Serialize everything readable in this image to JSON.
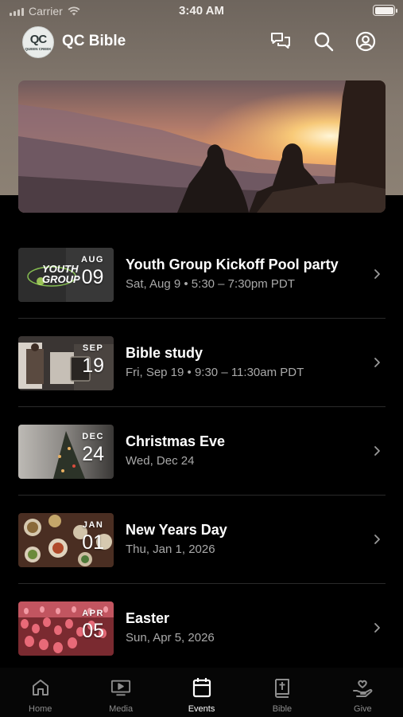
{
  "status_bar": {
    "carrier": "Carrier",
    "time": "3:40 AM"
  },
  "header": {
    "app_title": "QC Bible",
    "logo_mark": "QC",
    "logo_sub": "QUEEN CREEK",
    "icons": [
      "chat-icon",
      "search-icon",
      "account-icon"
    ]
  },
  "hero": {
    "image": "sunset-mountain-people"
  },
  "events": [
    {
      "title": "Youth Group Kickoff Pool party",
      "subtitle": "Sat, Aug 9 • 5:30 – 7:30pm PDT",
      "month": "AUG",
      "day": "09",
      "thumb_text": "YOUTH GROUP"
    },
    {
      "title": "Bible study",
      "subtitle": "Fri, Sep 19 • 9:30 – 11:30am PDT",
      "month": "SEP",
      "day": "19"
    },
    {
      "title": "Christmas Eve",
      "subtitle": "Wed, Dec 24",
      "month": "DEC",
      "day": "24"
    },
    {
      "title": "New Years Day",
      "subtitle": "Thu, Jan 1, 2026",
      "month": "JAN",
      "day": "01"
    },
    {
      "title": "Easter",
      "subtitle": "Sun, Apr 5, 2026",
      "month": "APR",
      "day": "05"
    }
  ],
  "tabs": [
    {
      "label": "Home",
      "icon": "home-icon"
    },
    {
      "label": "Media",
      "icon": "tv-icon"
    },
    {
      "label": "Events",
      "icon": "calendar-icon",
      "active": true
    },
    {
      "label": "Bible",
      "icon": "bible-icon"
    },
    {
      "label": "Give",
      "icon": "give-icon"
    }
  ],
  "colors": {
    "header_bg": "#857a6f",
    "background": "#000000",
    "subtitle_text": "#a9a9a9",
    "inactive_tab": "#8d8d8d"
  }
}
